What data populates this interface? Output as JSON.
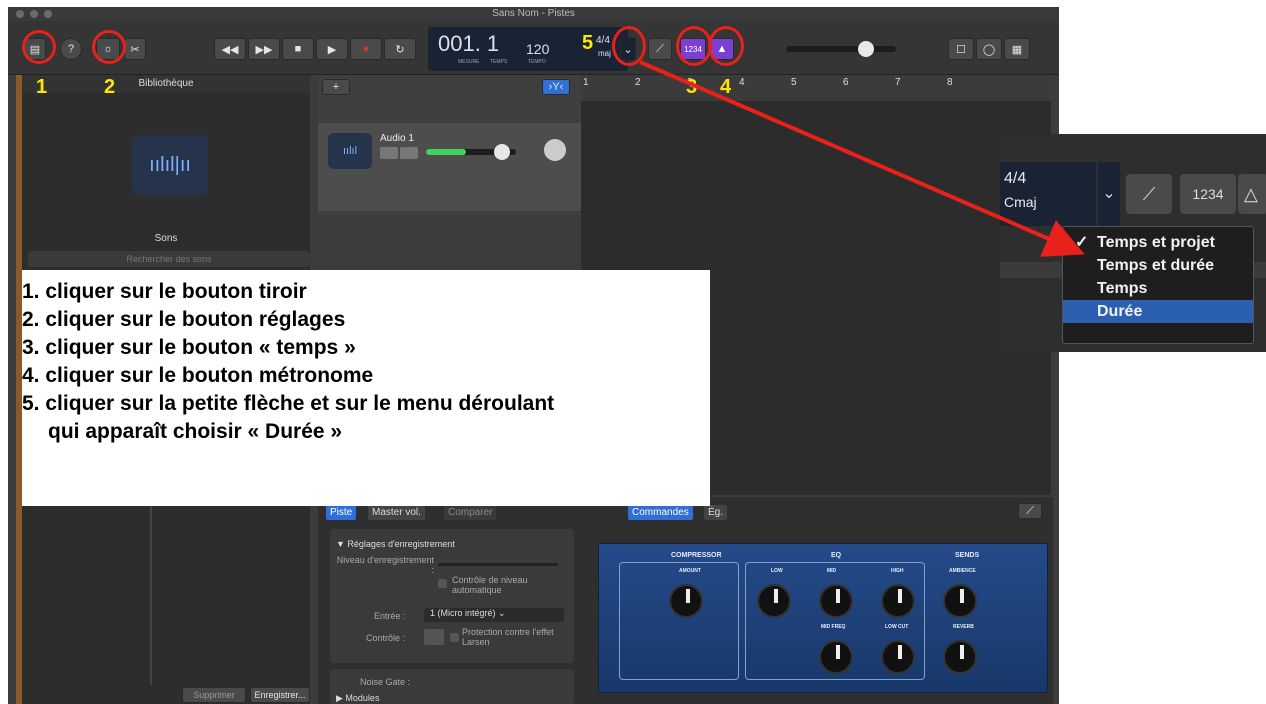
{
  "window": {
    "title": "Sans Nom - Pistes"
  },
  "lcd": {
    "bar": "001. 1",
    "bar_label": "MESURE",
    "beat_label": "TEMPS",
    "tempo": "120",
    "tempo_label": "TEMPO",
    "sig": "4/4",
    "key": "maj"
  },
  "toolbar": {
    "count_in": "1234"
  },
  "library": {
    "title": "Bibliothèque",
    "sounds": "Sons",
    "search_placeholder": "Rechercher des sons",
    "delete": "Supprimer",
    "record": "Enregistrer..."
  },
  "track": {
    "name": "Audio 1"
  },
  "ruler": {
    "marks": [
      "1",
      "2",
      "3",
      "4",
      "5",
      "6",
      "7",
      "8"
    ]
  },
  "smart": {
    "tab_piste": "Piste",
    "tab_master": "Master vol.",
    "tab_compare": "Comparer",
    "tab_commands": "Commandes",
    "tab_eq": "Ég.",
    "rec_settings": "Réglages d'enregistrement",
    "level_label": "Niveau d'enregistrement :",
    "auto_level": "Contrôle de niveau automatique",
    "input_label": "Entrée :",
    "input_value": "1 (Micro intégré)",
    "monitor_label": "Contrôle :",
    "feedback": "Protection contre l'effet Larsen",
    "noise_gate": "Noise Gate :",
    "modules": "Modules"
  },
  "amp": {
    "compressor": "COMPRESSOR",
    "eq": "EQ",
    "sends": "SENDS",
    "amount": "AMOUNT",
    "low": "LOW",
    "mid": "MID",
    "high": "HIGH",
    "ambience": "AMBIENCE",
    "mid_freq": "MID FREQ",
    "low_cut": "LOW CUT",
    "reverb": "REVERB"
  },
  "instructions": [
    "1. cliquer sur le bouton tiroir",
    "2. cliquer sur le bouton réglages",
    "3. cliquer sur le bouton « temps »",
    "4. cliquer sur le bouton métronome",
    "5. cliquer sur la petite flèche et sur le menu déroulant",
    "qui apparaît choisir « Durée »"
  ],
  "callouts": {
    "n1": "1",
    "n2": "2",
    "n3": "3",
    "n4": "4",
    "n5": "5"
  },
  "zoom": {
    "sig": "4/4",
    "key": "Cmaj",
    "count_in": "1234"
  },
  "menu": {
    "items": [
      "Temps et projet",
      "Temps et durée",
      "Temps",
      "Durée"
    ],
    "checked_index": 0,
    "selected_index": 3
  },
  "colors": {
    "annotation": "#e8211a",
    "callout_number": "#ffe600",
    "selection": "#2b5fb0",
    "lcd": "#1a2333"
  }
}
